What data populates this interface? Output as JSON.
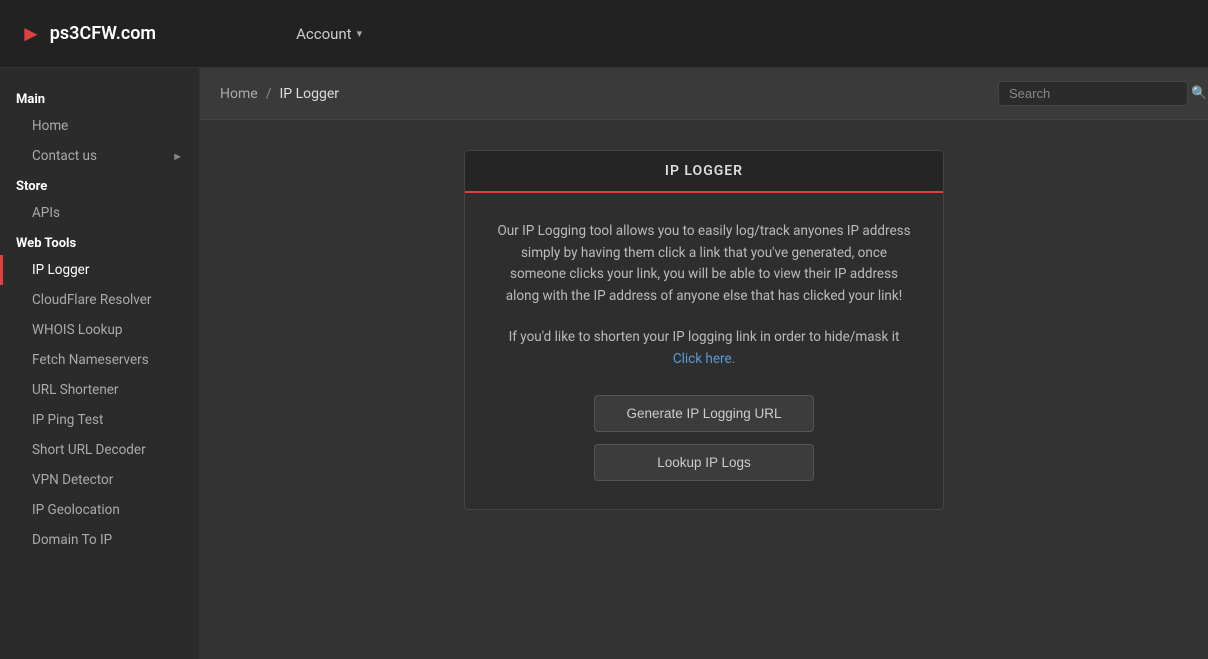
{
  "topNav": {
    "logoText": "ps3CFW.com",
    "accountLabel": "Account"
  },
  "sidebar": {
    "sections": [
      {
        "label": "Main",
        "items": [
          {
            "id": "home",
            "label": "Home",
            "active": false,
            "hasChevron": false
          },
          {
            "id": "contact-us",
            "label": "Contact us",
            "active": false,
            "hasChevron": true
          }
        ]
      },
      {
        "label": "Store",
        "items": [
          {
            "id": "apis",
            "label": "APIs",
            "active": false,
            "hasChevron": false
          }
        ]
      },
      {
        "label": "Web Tools",
        "items": [
          {
            "id": "ip-logger",
            "label": "IP Logger",
            "active": true,
            "hasChevron": false
          },
          {
            "id": "cloudflare-resolver",
            "label": "CloudFlare Resolver",
            "active": false,
            "hasChevron": false
          },
          {
            "id": "whois-lookup",
            "label": "WHOIS Lookup",
            "active": false,
            "hasChevron": false
          },
          {
            "id": "fetch-nameservers",
            "label": "Fetch Nameservers",
            "active": false,
            "hasChevron": false
          },
          {
            "id": "url-shortener",
            "label": "URL Shortener",
            "active": false,
            "hasChevron": false
          },
          {
            "id": "ip-ping-test",
            "label": "IP Ping Test",
            "active": false,
            "hasChevron": false
          },
          {
            "id": "short-url-decoder",
            "label": "Short URL Decoder",
            "active": false,
            "hasChevron": false
          },
          {
            "id": "vpn-detector",
            "label": "VPN Detector",
            "active": false,
            "hasChevron": false
          },
          {
            "id": "ip-geolocation",
            "label": "IP Geolocation",
            "active": false,
            "hasChevron": false
          },
          {
            "id": "domain-to-ip",
            "label": "Domain To IP",
            "active": false,
            "hasChevron": false
          }
        ]
      }
    ]
  },
  "breadcrumb": {
    "homeLabel": "Home",
    "separator": "/",
    "currentLabel": "IP Logger"
  },
  "search": {
    "placeholder": "Search"
  },
  "card": {
    "headerLabel": "IP LOGGER",
    "description1": "Our IP Logging tool allows you to easily log/track anyones IP address simply by having them click a link that you've generated, once someone clicks your link, you will be able to view their IP address along with the IP address of anyone else that has clicked your link!",
    "description2": "If you'd like to shorten your IP logging link in order to hide/mask it",
    "linkText": "Click here.",
    "btn1Label": "Generate IP Logging URL",
    "btn2Label": "Lookup IP Logs"
  }
}
